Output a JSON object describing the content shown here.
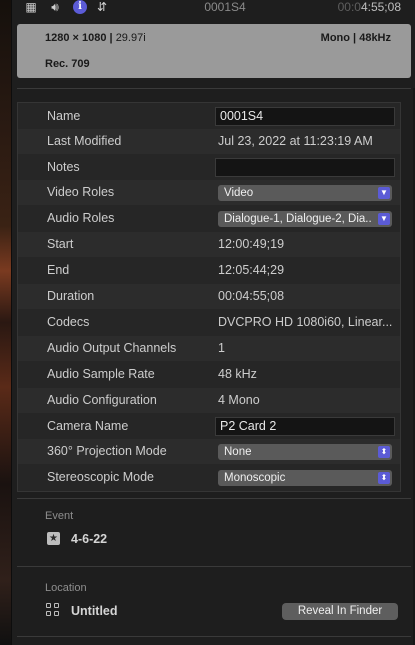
{
  "topbar": {
    "clip_name": "0001S4",
    "timecode_dim": "00:0",
    "timecode": "4:55;08"
  },
  "format": {
    "resolution": "1280 × 1080",
    "frame_rate": "29.97i",
    "audio_channels": "Mono",
    "sample_rate": "48kHz",
    "color_space": "Rec. 709"
  },
  "properties": [
    {
      "label": "Name",
      "value": "0001S4",
      "kind": "field"
    },
    {
      "label": "Last Modified",
      "value": "Jul 23, 2022 at 11:23:19 AM",
      "kind": "text"
    },
    {
      "label": "Notes",
      "value": "",
      "kind": "field"
    },
    {
      "label": "Video Roles",
      "value": "Video",
      "kind": "popup"
    },
    {
      "label": "Audio Roles",
      "value": "Dialogue-1, Dialogue-2, Dia...",
      "kind": "popup"
    },
    {
      "label": "Start",
      "value": "12:00:49;19",
      "kind": "text"
    },
    {
      "label": "End",
      "value": "12:05:44;29",
      "kind": "text"
    },
    {
      "label": "Duration",
      "value": "00:04:55;08",
      "kind": "text"
    },
    {
      "label": "Codecs",
      "value": "DVCPRO HD 1080i60, Linear...",
      "kind": "text"
    },
    {
      "label": "Audio Output Channels",
      "value": "1",
      "kind": "text"
    },
    {
      "label": "Audio Sample Rate",
      "value": "48 kHz",
      "kind": "text"
    },
    {
      "label": "Audio Configuration",
      "value": "4 Mono",
      "kind": "text"
    },
    {
      "label": "Camera Name",
      "value": "P2 Card 2",
      "kind": "field"
    },
    {
      "label": "360° Projection Mode",
      "value": "None",
      "kind": "popup"
    },
    {
      "label": "Stereoscopic Mode",
      "value": "Monoscopic",
      "kind": "popup"
    }
  ],
  "event": {
    "label": "Event",
    "value": "4-6-22"
  },
  "location": {
    "label": "Location",
    "value": "Untitled",
    "button_label": "Reveal In Finder"
  }
}
